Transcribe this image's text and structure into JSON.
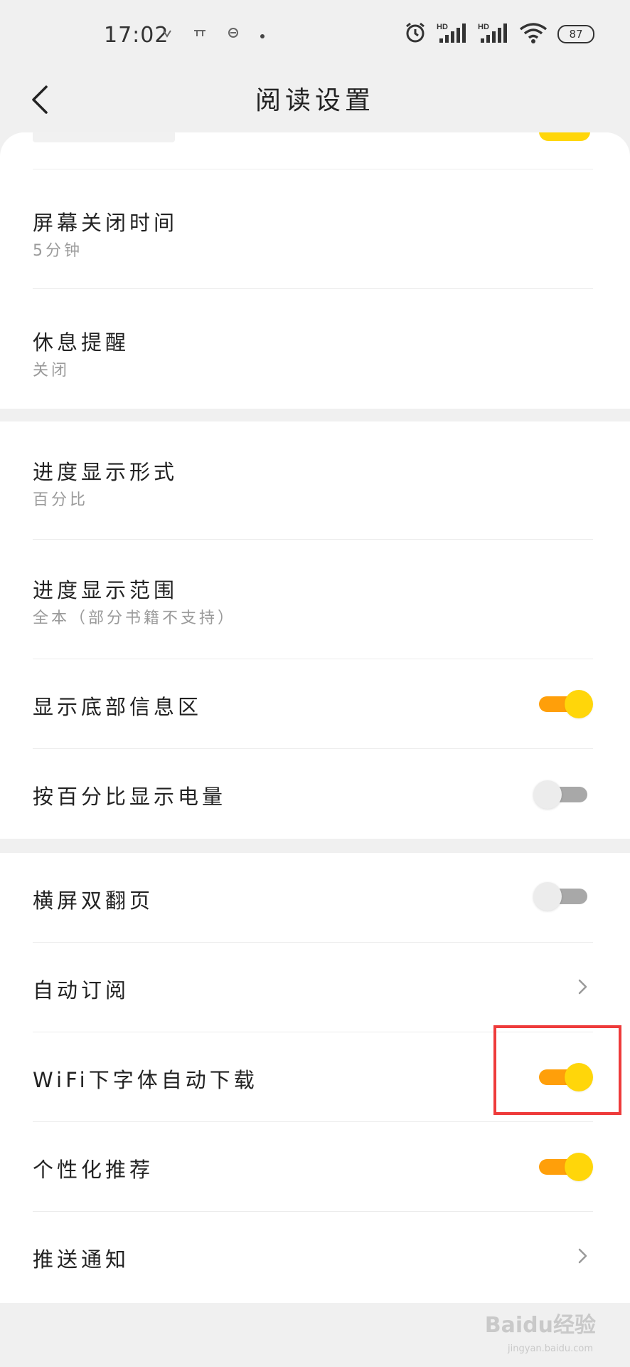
{
  "status_bar": {
    "time": "17:02",
    "battery": "87",
    "signal_label_1": "HD",
    "signal_label_2": "HD"
  },
  "header": {
    "title": "阅读设置"
  },
  "section1": {
    "items": [
      {
        "title": "屏幕关闭时间",
        "subtitle": "5分钟"
      },
      {
        "title": "休息提醒",
        "subtitle": "关闭"
      }
    ]
  },
  "section2": {
    "items": [
      {
        "title": "进度显示形式",
        "subtitle": "百分比"
      },
      {
        "title": "进度显示范围",
        "subtitle": "全本（部分书籍不支持）"
      },
      {
        "title": "显示底部信息区",
        "toggle": true
      },
      {
        "title": "按百分比显示电量",
        "toggle": false
      }
    ]
  },
  "section3": {
    "items": [
      {
        "title": "横屏双翻页",
        "toggle": false
      },
      {
        "title": "自动订阅",
        "control": "chevron-right-icon"
      },
      {
        "title": "WiFi下字体自动下载",
        "toggle": true
      },
      {
        "title": "个性化推荐",
        "toggle": true
      },
      {
        "title": "推送通知",
        "control": "chevron-right-icon"
      }
    ]
  },
  "colors": {
    "toggle_on_track": "#ff9f0a",
    "toggle_on_knob": "#ffd60a",
    "toggle_off_track": "#a8a8a8",
    "highlight": "#ee3b3b"
  },
  "watermark": {
    "text": "Baidu经验",
    "sub": "jingyan.baidu.com"
  }
}
